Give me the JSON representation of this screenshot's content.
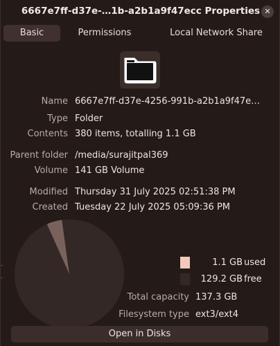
{
  "window": {
    "title": "6667e7ff-d37e-…1b-a2b1a9f47ecc Properties",
    "close_glyph": "✕"
  },
  "tabs": [
    {
      "label": "Basic",
      "active": true
    },
    {
      "label": "Permissions",
      "active": false
    },
    {
      "label": "Local Network Share",
      "active": false
    }
  ],
  "icon": {
    "name": "folder-icon"
  },
  "details": {
    "name_label": "Name",
    "name_value": "6667e7ff-d37e-4256-991b-a2b1a9f47e…",
    "type_label": "Type",
    "type_value": "Folder",
    "contents_label": "Contents",
    "contents_value": "380 items, totalling 1.1 GB",
    "parent_label": "Parent folder",
    "parent_value": "/media/surajitpal369",
    "volume_label": "Volume",
    "volume_value": "141 GB Volume",
    "modified_label": "Modified",
    "modified_value": "Thursday 31 July 2025 02:51:38 PM",
    "created_label": "Created",
    "created_value": "Tuesday 22 July 2025 05:09:36 PM"
  },
  "usage": {
    "used_size": "1.1 GB",
    "used_word": "used",
    "free_size": "129.2 GB",
    "free_word": "free",
    "used_fraction": 0.008,
    "used_color": "#f4c9bd",
    "free_color": "#332826",
    "slice_color": "#7a625c",
    "total_label": "Total capacity",
    "total_value": "137.3 GB",
    "fs_label": "Filesystem type",
    "fs_value": "ext3/ext4"
  },
  "actions": {
    "open_in_disks": "Open in Disks"
  },
  "colors": {
    "window_bg": "#241b19",
    "active_tab_bg": "#40312e",
    "button_bg": "#3a2d2a"
  }
}
